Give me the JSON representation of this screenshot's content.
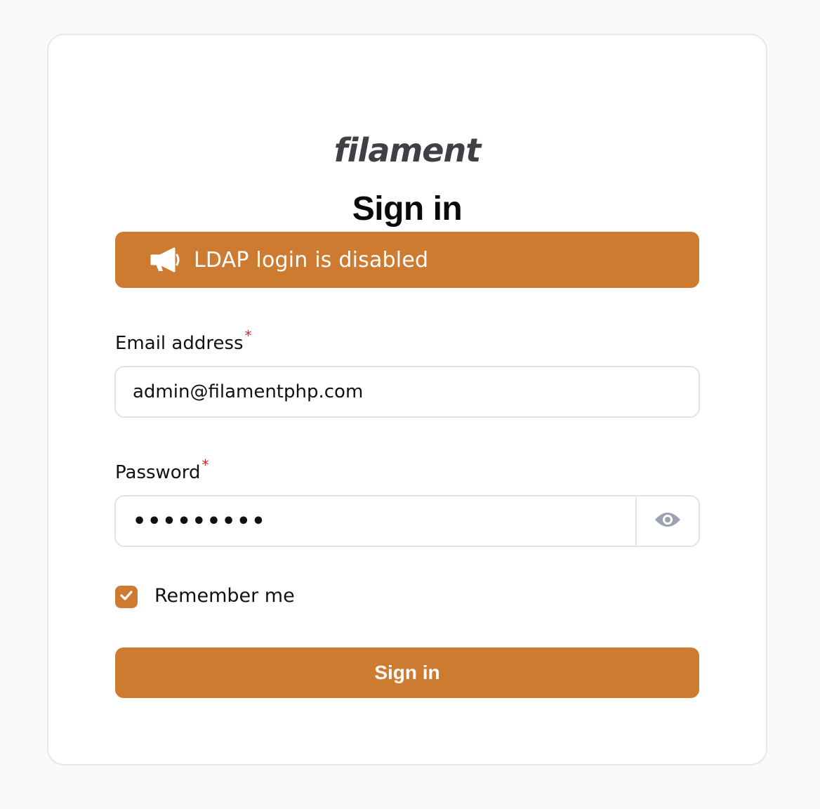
{
  "brand": {
    "logo_text": "filament"
  },
  "page": {
    "title": "Sign in"
  },
  "banner": {
    "icon": "megaphone-icon",
    "text": "LDAP login is disabled",
    "color": "#cc7b30"
  },
  "form": {
    "email": {
      "label": "Email address",
      "required_mark": "*",
      "value": "admin@filamentphp.com"
    },
    "password": {
      "label": "Password",
      "required_mark": "*",
      "value": "•••••••••",
      "toggle_icon": "eye-icon"
    },
    "remember": {
      "label": "Remember me",
      "checked": true
    },
    "submit_label": "Sign in"
  },
  "colors": {
    "primary": "#cc7b30",
    "required": "#dc2626"
  }
}
